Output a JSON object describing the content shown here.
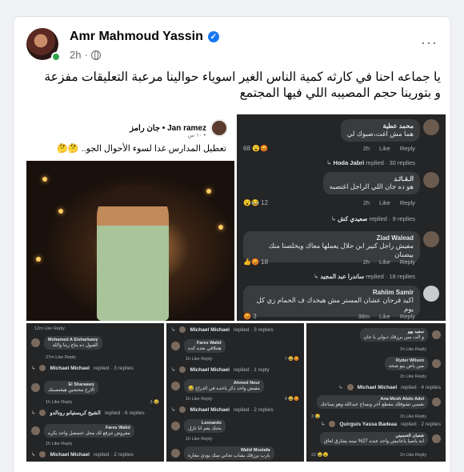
{
  "post": {
    "author": "Amr Mahmoud Yassin",
    "time": "2h",
    "text_line1": "يا جماعه احنا في كارثه كمية الناس الغير اسوياء حوالينا مرعبة  التعليقات مفزعة",
    "text_line2": "و بتورينا حجم المصيبه اللي فيها المجتمع"
  },
  "tweet": {
    "name": "Jan ramez • جان رامز",
    "sub": "١٠ س •",
    "text": "تعطيل المدارس غدا لسوء الأحوال الجو.. 🤔🤔"
  },
  "comments_right": [
    {
      "name": "محمد عطية",
      "text": "هما مش اغت،صبوك لي",
      "time": "2h",
      "like": "Like",
      "reply": "Reply",
      "count": "68",
      "replies_name": "Hoda Jabri",
      "replies_text": "replied · 30 replies"
    },
    {
      "name": "الـقـائـد",
      "text": "هو ده جان اللي الراجل اغتصبه",
      "time": "2h",
      "like": "Like",
      "reply": "Reply",
      "count": "12",
      "replies_name": "صعيدي كش",
      "replies_text": "replied · 9 replies"
    },
    {
      "name": "Ziad Walead",
      "text": "مفيش راجل كبير ابن حلال يعملها معاك ويخلصنا منك بيضنان",
      "time": "2h",
      "like": "Like",
      "reply": "Reply",
      "count": "18",
      "replies_name": "ساندرا عبد المجيد",
      "replies_text": "replied · 18 replies"
    },
    {
      "name": "Rahiim Samir",
      "text": "اكيد فرحان عشان المستر مش هيخدك ف الحمام زي كل يوم",
      "time": "38m",
      "like": "Like",
      "reply": "Reply",
      "count": "3"
    }
  ],
  "b1": {
    "top_row": "12m   Like   Reply",
    "c1_name": "Mohamed A Elsharkawy",
    "c1_text": "القبول ده يتاع ربنا والله",
    "c1_acts": "27m   Like   Reply",
    "r1_name": "Michael Michael",
    "r1_text": "replied · 3 replies",
    "c2_name": "El Sharaawy",
    "c2_text": "الارخ محتجين هيغتصبنك",
    "c2_acts": "1h   Like   Reply",
    "c2_count": "3",
    "r2_name": "الشيخ كريستيانو رونالدو",
    "r2_text": "replied · 6 replies",
    "c3_name": "Fares Walid",
    "c3_text": "مفروض تترفع لك محل ختمصل واحد بكره",
    "c3_acts": "1h   Like   Reply",
    "r3_name": "Michael Michael",
    "r3_text": "replied · 2 replies"
  },
  "b2": {
    "r0_name": "Michael Michael",
    "r0_text": "replied · 3 replies",
    "c1_name": "Fares Walid",
    "c1_text": "هتتلاقي بعده كده",
    "c1_acts": "1h   Like   Reply",
    "c1_count": "7",
    "r1_name": "Michael Michael",
    "r1_text": "replied · 1 reply",
    "c2_name": "Ahmed Nour",
    "c2_text": "مفيش واحد ذكر ياخده في الدراج 😂",
    "c2_acts": "1h   Like   Reply",
    "c2_count": "4",
    "r2_name": "Michael Michael",
    "r2_text": "replied · 2 replies",
    "c3_name": "Leonardo",
    "c3_text": "بحنك يعم انا نازل",
    "c3_acts": "1h   Like   Reply",
    "c4_name": "Walid Mostafa",
    "c4_text": "بارب يرزقك بشاب تحاني ميك يودي مغارة"
  },
  "b3": {
    "c1_name": "سعيد بهو",
    "c1_text": "و الت مين يرزقك ذيولي يا جان",
    "c1_acts": "1h   Like   Reply",
    "c2_name": "Ryder Wilson",
    "c2_text": "مين ياض يبو شخه",
    "c2_acts": "1h   Like   Reply",
    "r2_name": "Michael Michael",
    "r2_text": "replied · 4 replies",
    "c3_name": "Ana Mesh Abdo Adel",
    "c3_text": "نفسي تشوفلك مقطع آخر ونساح عبدالله وهو يساعك",
    "c3_acts": "1h   Like   Reply",
    "c3_count": "3",
    "r3_name": "Quirguis Yassa Badeaa",
    "r3_text": "replied · 2 replies",
    "c4_name": "شعبان الحسيني",
    "c4_text": "انه ياصيا ياعانيش واحد عنده 27% سنه بشارق لعاق",
    "c4_acts": "1h   Like   Reply",
    "c4_count": "22"
  }
}
